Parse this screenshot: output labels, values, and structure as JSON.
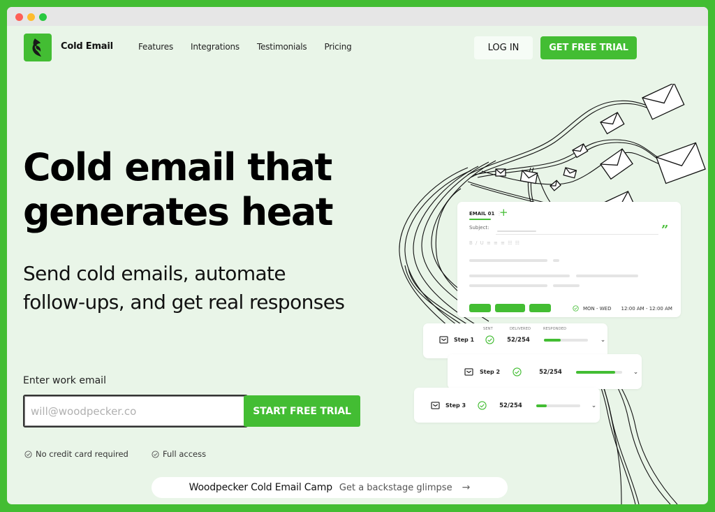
{
  "window": {
    "controls": [
      "close",
      "minimize",
      "maximize"
    ]
  },
  "header": {
    "brand": "Cold Email",
    "logo_icon": "woodpecker-bird-icon",
    "nav": [
      "Features",
      "Integrations",
      "Testimonials",
      "Pricing"
    ],
    "login_label": "LOG IN",
    "trial_label": "GET FREE TRIAL"
  },
  "hero": {
    "headline_bold": "Cold email",
    "headline_rest": "that",
    "headline_line2": "generates heat",
    "subhead": "Send cold emails, automate follow-ups, and get real responses",
    "email_label": "Enter work email",
    "email_placeholder": "will@woodpecker.co",
    "start_label": "START FREE TRIAL",
    "perks": [
      "No credit card required",
      "Full access"
    ]
  },
  "camp": {
    "title": "Woodpecker Cold Email Camp",
    "subtitle": "Get a backstage glimpse",
    "arrow_icon": "arrow-right-icon"
  },
  "email_card": {
    "tab": "EMAIL 01",
    "add_icon": "plus-icon",
    "subject_label": "Subject:",
    "quote_icon": "quote-icon",
    "format_toolbar": "B / U  ≡ ≡ ≡  ☷ ☷",
    "days": "MON - WED",
    "hours": "12:00 AM - 12:00 AM"
  },
  "steps": {
    "columns": [
      "SENT",
      "DELIVERED",
      "RESPONDED"
    ],
    "rows": [
      {
        "name": "Step 1",
        "sent": true,
        "delivered": "52/254",
        "responded_progress": 0.38
      },
      {
        "name": "Step 2",
        "sent": true,
        "delivered": "52/254",
        "responded_progress": 0.85
      },
      {
        "name": "Step 3",
        "sent": true,
        "delivered": "52/254",
        "responded_progress": 0.24
      }
    ]
  },
  "colors": {
    "brand_green": "#43bd33",
    "page_bg": "#e9f5e8"
  }
}
